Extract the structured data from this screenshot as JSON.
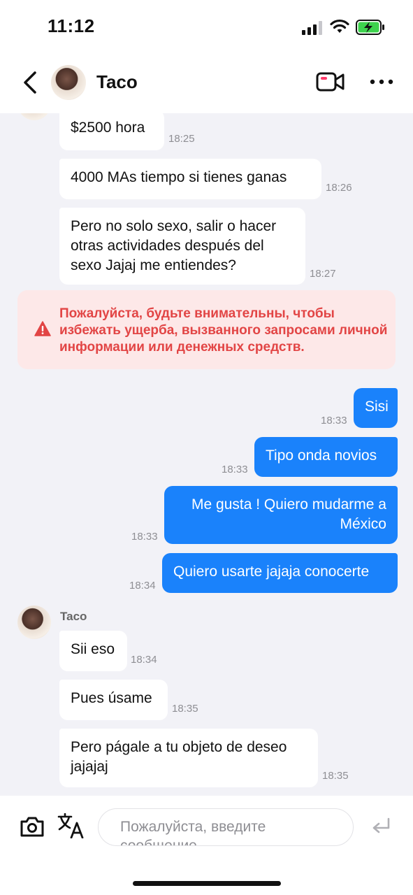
{
  "status_bar": {
    "time": "11:12"
  },
  "header": {
    "contact_name": "Taco"
  },
  "messages_top": [
    {
      "text": "$2500 hora",
      "time": "18:25"
    },
    {
      "text": "4000 MAs tiempo si tienes ganas",
      "time": "18:26"
    },
    {
      "text": "Pero no solo sexo, salir o hacer otras actividades después del sexo Jajaj me entiendes?",
      "time": "18:27"
    }
  ],
  "warning": {
    "text": "Пожалуйста, будьте внимательны, чтобы избежать ущерба, вызванного запросами личной информации или денежных средств."
  },
  "messages_out": [
    {
      "text": "Sisi",
      "time": "18:33"
    },
    {
      "text": "Tipo onda novios",
      "time": "18:33"
    },
    {
      "text": "Me gusta ! Quiero mudarme a México",
      "time": "18:33"
    },
    {
      "text": "Quiero usarte jajaja conocerte",
      "time": "18:34"
    }
  ],
  "sender": {
    "name": "Taco"
  },
  "messages_bottom": [
    {
      "text": "Sii eso",
      "time": "18:34"
    },
    {
      "text": "Pues úsame",
      "time": "18:35"
    },
    {
      "text": "Pero págale a tu objeto de deseo jajajaj",
      "time": "18:35"
    }
  ],
  "input": {
    "placeholder": "Пожалуйста, введите сообщение"
  },
  "colors": {
    "outgoing_bubble": "#1a82fb",
    "warning_text": "#e24545",
    "warning_bg": "#fde8e8"
  }
}
